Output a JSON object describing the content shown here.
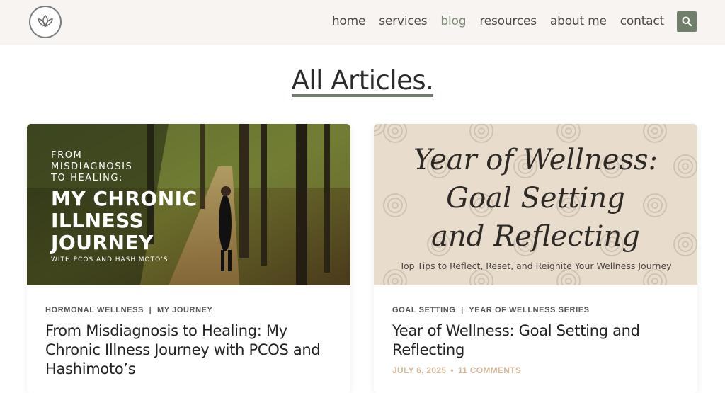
{
  "nav": {
    "items": [
      "home",
      "services",
      "blog",
      "resources",
      "about me",
      "contact"
    ],
    "active": "blog"
  },
  "page": {
    "title": "All Articles."
  },
  "colors": {
    "accent": "#6f7f6a",
    "header_bg": "#f8f4f1",
    "meta": "#d4b898"
  },
  "icons": {
    "logo": "lotus-icon",
    "search": "search-icon"
  },
  "articles": [
    {
      "image": {
        "line1": "FROM",
        "line2": "MISDIAGNOSIS",
        "line3": "TO HEALING:",
        "big1": "MY CHRONIC",
        "big2": "ILLNESS",
        "big3": "JOURNEY",
        "small": "WITH PCOS AND HASHIMOTO'S"
      },
      "categories": [
        "HORMONAL WELLNESS",
        "MY JOURNEY"
      ],
      "title": "From Misdiagnosis to Healing: My Chronic Illness Journey with PCOS and Hashimoto’s"
    },
    {
      "image": {
        "script1": "Year of Wellness:",
        "script2": "Goal Setting",
        "script3": "and Reflecting",
        "tagline": "Top Tips to Reflect, Reset, and Reignite Your Wellness Journey"
      },
      "categories": [
        "GOAL SETTING",
        "YEAR OF WELLNESS SERIES"
      ],
      "title": "Year of Wellness: Goal Setting and Reflecting",
      "date": "JULY 6, 2025",
      "comments": "11 COMMENTS"
    }
  ]
}
